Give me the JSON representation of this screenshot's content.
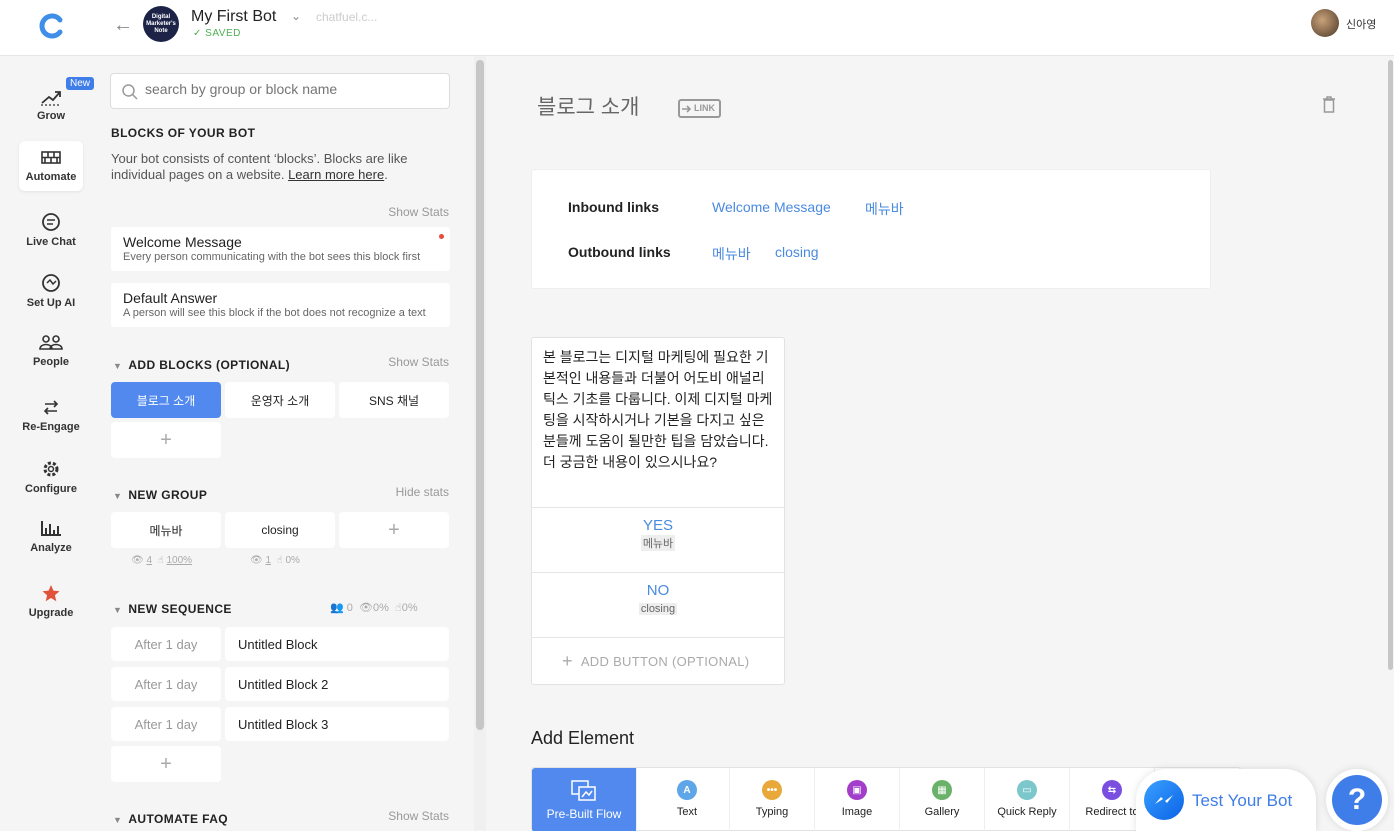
{
  "header": {
    "bot_avatar_text": "Digital Marketer's Note",
    "bot_name": "My First Bot",
    "bot_url": "chatfuel.c...",
    "saved_label": "SAVED",
    "user_name": "신아영"
  },
  "nav": {
    "new_badge": "New",
    "items": [
      {
        "label": "Grow",
        "icon": "grow-icon"
      },
      {
        "label": "Automate",
        "icon": "automate-icon"
      },
      {
        "label": "Live Chat",
        "icon": "live-chat-icon"
      },
      {
        "label": "Set Up AI",
        "icon": "ai-icon"
      },
      {
        "label": "People",
        "icon": "people-icon"
      },
      {
        "label": "Re-Engage",
        "icon": "re-engage-icon"
      },
      {
        "label": "Configure",
        "icon": "gear-icon"
      },
      {
        "label": "Analyze",
        "icon": "chart-icon"
      },
      {
        "label": "Upgrade",
        "icon": "star-icon"
      }
    ]
  },
  "panel": {
    "search_placeholder": "search by group or block name",
    "blocks_title": "BLOCKS OF YOUR BOT",
    "blocks_desc": "Your bot consists of content ‘blocks’. Blocks are like individual pages on a website.",
    "learn_more": "Learn more here",
    "show_stats": "Show Stats",
    "hide_stats": "Hide stats",
    "welcome": {
      "title": "Welcome Message",
      "sub": "Every person communicating with the bot sees this block first"
    },
    "default": {
      "title": "Default Answer",
      "sub": "A person will see this block if the bot does not recognize a text"
    },
    "add_blocks_title": "ADD BLOCKS (OPTIONAL)",
    "add_blocks": [
      "블로그 소개",
      "운영자 소개",
      "SNS 채널"
    ],
    "new_group_title": "NEW GROUP",
    "group_blocks": [
      "메뉴바",
      "closing"
    ],
    "group_stats": [
      {
        "views": "4",
        "clicks": "100%"
      },
      {
        "views": "1",
        "clicks": "0%"
      }
    ],
    "sequence_title": "NEW SEQUENCE",
    "sequence_stats": {
      "users": "0",
      "views": "0%",
      "clicks": "0%"
    },
    "sequence": [
      {
        "delay": "After 1 day",
        "block": "Untitled Block"
      },
      {
        "delay": "After 1 day",
        "block": "Untitled Block 2"
      },
      {
        "delay": "After 1 day",
        "block": "Untitled Block 3"
      }
    ],
    "faq_title": "AUTOMATE FAQ",
    "plus": "+"
  },
  "editor": {
    "block_title": "블로그 소개",
    "link_badge": "LINK",
    "inbound_label": "Inbound links",
    "inbound": [
      "Welcome Message",
      "메뉴바"
    ],
    "outbound_label": "Outbound links",
    "outbound": [
      "메뉴바",
      "closing"
    ],
    "text": "본 블로그는 디지털 마케팅에 필요한 기본적인 내용들과 더불어 어도비 애널리틱스 기초를 다룹니다.  이제 디지털 마케팅을 시작하시거나 기본을 다지고 싶은 분들께 도움이 될만한 팁을 담았습니다. 더 궁금한 내용이 있으시나요?",
    "buttons": [
      {
        "label": "YES",
        "target": "메뉴바"
      },
      {
        "label": "NO",
        "target": "closing"
      }
    ],
    "add_button": "ADD BUTTON (OPTIONAL)",
    "add_element_title": "Add Element",
    "elements": [
      {
        "label": "Pre-Built Flow",
        "color": "#5189ee"
      },
      {
        "label": "Text",
        "glyph": "A",
        "color": "#5ea6e8"
      },
      {
        "label": "Typing",
        "glyph": "•••",
        "color": "#e8a93a"
      },
      {
        "label": "Image",
        "glyph": "▣",
        "color": "#a23ec9"
      },
      {
        "label": "Gallery",
        "glyph": "▦",
        "color": "#6ab26a"
      },
      {
        "label": "Quick Reply",
        "glyph": "▭",
        "color": "#7cc7cc"
      },
      {
        "label": "Redirect to",
        "glyph": "⇆",
        "color": "#7a4fe0"
      }
    ]
  },
  "widgets": {
    "test_bot": "Test Your Bot",
    "help": "?"
  }
}
